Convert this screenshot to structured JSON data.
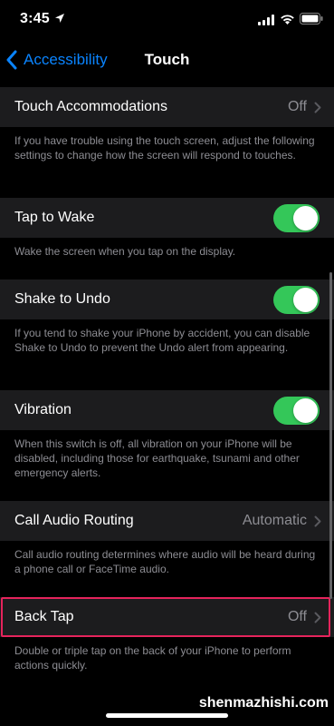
{
  "status": {
    "time": "3:45"
  },
  "nav": {
    "back_label": "Accessibility",
    "title": "Touch"
  },
  "cells": [
    {
      "label": "Touch Accommodations",
      "value": "Off",
      "type": "disclosure",
      "footer": "If you have trouble using the touch screen, adjust the following settings to change how the screen will respond to touches."
    },
    {
      "label": "Tap to Wake",
      "type": "toggle",
      "on": true,
      "footer": "Wake the screen when you tap on the display."
    },
    {
      "label": "Shake to Undo",
      "type": "toggle",
      "on": true,
      "footer": "If you tend to shake your iPhone by accident, you can disable Shake to Undo to prevent the Undo alert from appearing."
    },
    {
      "label": "Vibration",
      "type": "toggle",
      "on": true,
      "footer": "When this switch is off, all vibration on your iPhone will be disabled, including those for earthquake, tsunami and other emergency alerts."
    },
    {
      "label": "Call Audio Routing",
      "value": "Automatic",
      "type": "disclosure",
      "footer": "Call audio routing determines where audio will be heard during a phone call or FaceTime audio."
    },
    {
      "label": "Back Tap",
      "value": "Off",
      "type": "disclosure",
      "highlighted": true,
      "footer": "Double or triple tap on the back of your iPhone to perform actions quickly."
    }
  ],
  "watermark": "shenmazhishi.com",
  "colors": {
    "accent": "#0a84ff",
    "toggle_on": "#34c759",
    "highlight": "#e5245c",
    "cell_bg": "#1c1c1e",
    "secondary_text": "#8d8d93"
  }
}
